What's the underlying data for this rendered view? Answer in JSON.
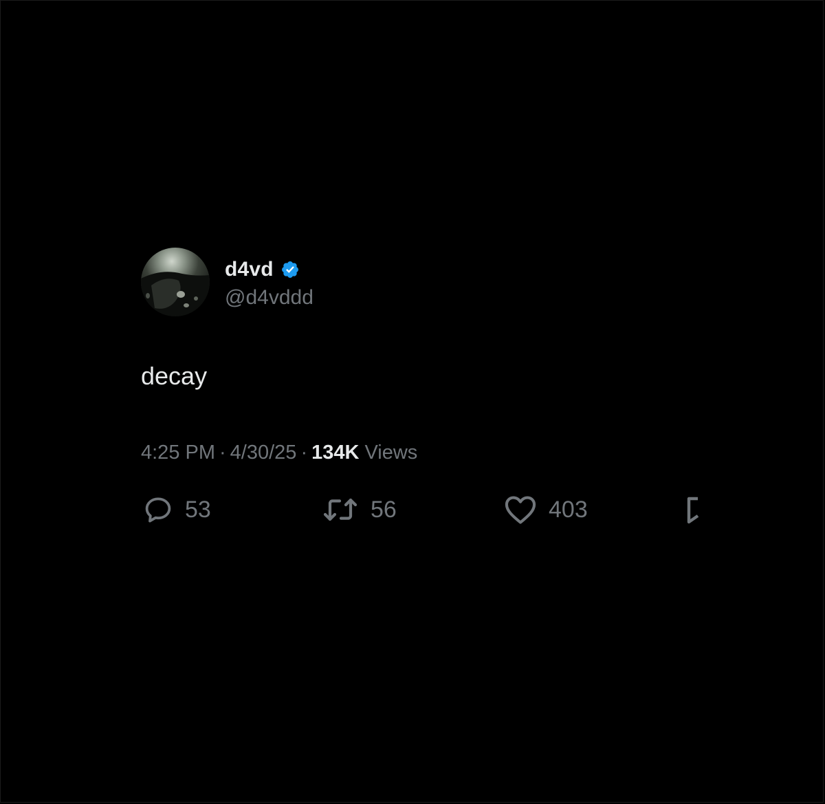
{
  "tweet": {
    "display_name": "d4vd",
    "handle": "@d4vddd",
    "verified": true,
    "text": "decay",
    "time": "4:25 PM",
    "separator": "·",
    "date": "4/30/25",
    "views_count": "134K",
    "views_label": "Views"
  },
  "actions": {
    "replies": "53",
    "retweets": "56",
    "likes": "403"
  },
  "colors": {
    "background": "#000000",
    "primary_text": "#e7e9ea",
    "secondary_text": "#71767b",
    "verified_badge": "#1d9bf0"
  }
}
